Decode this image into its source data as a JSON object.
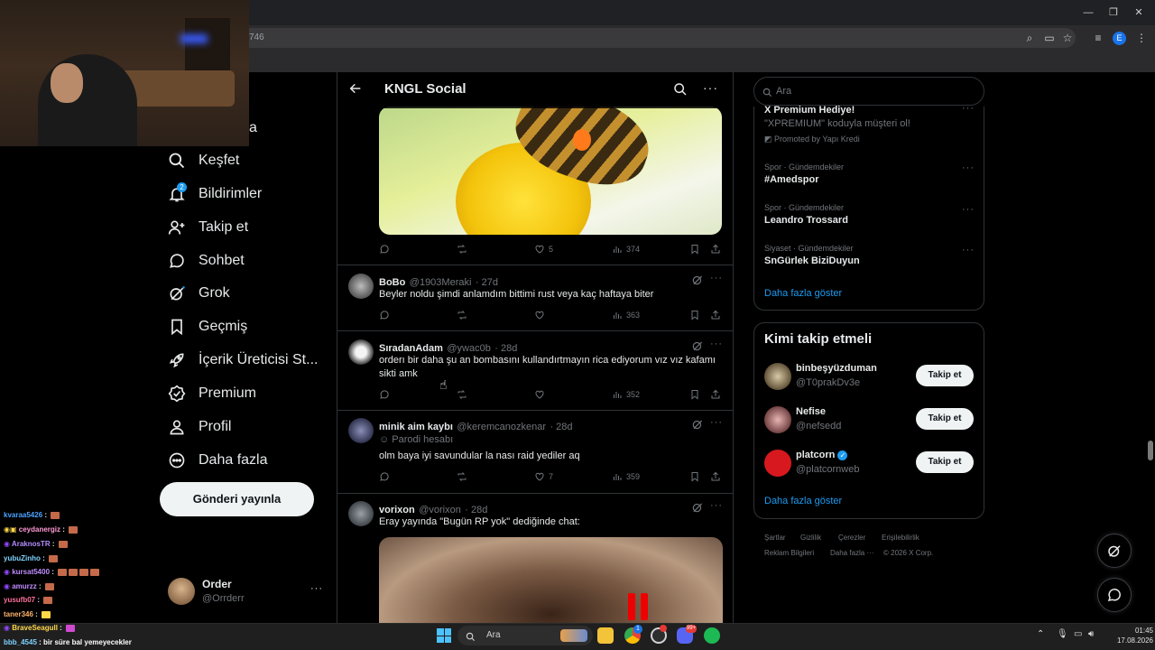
{
  "browser": {
    "url_fragment": "746",
    "profile_initial": "E"
  },
  "nav": {
    "partial_item": "a",
    "items": [
      {
        "label": "Keşfet",
        "icon": "search-icon"
      },
      {
        "label": "Bildirimler",
        "icon": "bell-icon",
        "badge": "2"
      },
      {
        "label": "Takip et",
        "icon": "add-person-icon"
      },
      {
        "label": "Sohbet",
        "icon": "chat-icon"
      },
      {
        "label": "Grok",
        "icon": "grok-icon"
      },
      {
        "label": "Geçmiş",
        "icon": "bookmark-icon"
      },
      {
        "label": "İçerik Üreticisi St...",
        "icon": "rocket-icon"
      },
      {
        "label": "Premium",
        "icon": "verified-icon"
      },
      {
        "label": "Profil",
        "icon": "person-icon"
      },
      {
        "label": "Daha fazla",
        "icon": "more-circle-icon"
      }
    ],
    "post_button": "Gönderi yayınla",
    "account": {
      "name": "Order",
      "handle": "@Orrderr"
    }
  },
  "header": {
    "title": "KNGL Social"
  },
  "tweets": [
    {
      "likes": "5",
      "views": "374"
    },
    {
      "name": "BoBo",
      "handle": "@1903Meraki",
      "time": "· 27d",
      "text": "Beyler noldu şimdi anlamdım bittimi rust veya kaç haftaya biter",
      "likes": "",
      "views": "363"
    },
    {
      "name": "SıradanAdam",
      "handle": "@ywac0b",
      "time": "· 28d",
      "text": "orderı bir daha şu an bombasını kullandırtmayın rica ediyorum vız vız kafamı sikti amk",
      "likes": "",
      "views": "352"
    },
    {
      "name": "minik aim kaybı",
      "handle": "@keremcanozkenar",
      "time": "· 28d",
      "label": "Parodi hesabı",
      "text": "olm baya iyi savundular la nası raid yediler aq",
      "likes": "7",
      "views": "359"
    },
    {
      "name": "vorixon",
      "handle": "@vorixon",
      "time": "· 28d",
      "text": "Eray yayında \"Bugün RP yok\" dediğinde chat:"
    }
  ],
  "search": {
    "placeholder": "Ara"
  },
  "trends": {
    "promo_title": "X Premium Hediye!",
    "promo_text": "\"XPREMIUM\" koduyla müşteri ol!",
    "promo_by": "Promoted by Yapı Kredi",
    "items": [
      {
        "meta": "Spor · Gündemdekiler",
        "title": "#Amedspor"
      },
      {
        "meta": "Spor · Gündemdekiler",
        "title": "Leandro Trossard"
      },
      {
        "meta": "Siyaset · Gündemdekiler",
        "title": "SnGürlek BiziDuyun"
      }
    ],
    "show_more": "Daha fazla göster"
  },
  "who_to_follow": {
    "title": "Kimi takip etmeli",
    "users": [
      {
        "name": "binbeşyüzduman",
        "handle": "@T0prakDv3e",
        "button": "Takip et"
      },
      {
        "name": "Nefise",
        "handle": "@nefsedd",
        "button": "Takip et"
      },
      {
        "name": "platcorn",
        "handle": "@platcornweb",
        "button": "Takip et",
        "verified": true
      }
    ],
    "show_more": "Daha fazla göster"
  },
  "footer": {
    "links": [
      "Şartlar",
      "Gizlilik",
      "Çerezler",
      "Erişilebilirlik",
      "Reklam Bilgileri",
      "Daha fazla ···",
      "© 2026 X Corp."
    ]
  },
  "chat": [
    {
      "user": "kvaraa5426",
      "color": "#4aa3ff"
    },
    {
      "user": "ceydanergiz",
      "color": "#ff9ad5"
    },
    {
      "user": "AraknosTR",
      "color": "#b58cff"
    },
    {
      "user": "yubuZinho",
      "color": "#7fd3ff"
    },
    {
      "user": "kursat5400",
      "color": "#c18cff"
    },
    {
      "user": "amurzz",
      "color": "#c18cff"
    },
    {
      "user": "yusufb07",
      "color": "#ff6f9a"
    },
    {
      "user": "taner346",
      "color": "#ffb36b"
    },
    {
      "user": "BraveSeagull",
      "color": "#ffd84a"
    },
    {
      "user": "bbb_4545",
      "color": "#7fd3ff",
      "message": "bir süre bal yemeyecekler"
    }
  ],
  "taskbar": {
    "search": "Ara",
    "time": "01:45",
    "date": "17.08.2026",
    "badge_chrome": "1",
    "badge_discord": "99+"
  }
}
